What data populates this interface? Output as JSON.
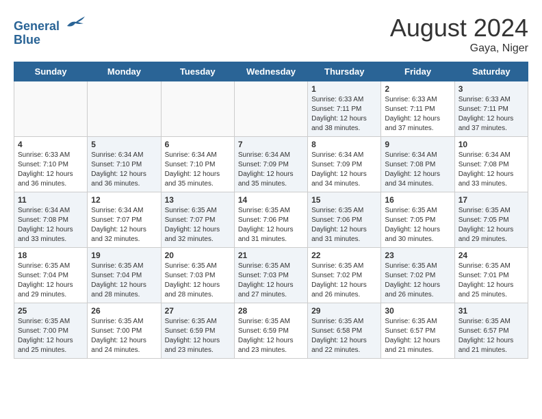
{
  "header": {
    "logo_line1": "General",
    "logo_line2": "Blue",
    "month_title": "August 2024",
    "location": "Gaya, Niger"
  },
  "days_of_week": [
    "Sunday",
    "Monday",
    "Tuesday",
    "Wednesday",
    "Thursday",
    "Friday",
    "Saturday"
  ],
  "weeks": [
    [
      {
        "day": "",
        "info": ""
      },
      {
        "day": "",
        "info": ""
      },
      {
        "day": "",
        "info": ""
      },
      {
        "day": "",
        "info": ""
      },
      {
        "day": "1",
        "info": "Sunrise: 6:33 AM\nSunset: 7:11 PM\nDaylight: 12 hours\nand 38 minutes."
      },
      {
        "day": "2",
        "info": "Sunrise: 6:33 AM\nSunset: 7:11 PM\nDaylight: 12 hours\nand 37 minutes."
      },
      {
        "day": "3",
        "info": "Sunrise: 6:33 AM\nSunset: 7:11 PM\nDaylight: 12 hours\nand 37 minutes."
      }
    ],
    [
      {
        "day": "4",
        "info": "Sunrise: 6:33 AM\nSunset: 7:10 PM\nDaylight: 12 hours\nand 36 minutes."
      },
      {
        "day": "5",
        "info": "Sunrise: 6:34 AM\nSunset: 7:10 PM\nDaylight: 12 hours\nand 36 minutes."
      },
      {
        "day": "6",
        "info": "Sunrise: 6:34 AM\nSunset: 7:10 PM\nDaylight: 12 hours\nand 35 minutes."
      },
      {
        "day": "7",
        "info": "Sunrise: 6:34 AM\nSunset: 7:09 PM\nDaylight: 12 hours\nand 35 minutes."
      },
      {
        "day": "8",
        "info": "Sunrise: 6:34 AM\nSunset: 7:09 PM\nDaylight: 12 hours\nand 34 minutes."
      },
      {
        "day": "9",
        "info": "Sunrise: 6:34 AM\nSunset: 7:08 PM\nDaylight: 12 hours\nand 34 minutes."
      },
      {
        "day": "10",
        "info": "Sunrise: 6:34 AM\nSunset: 7:08 PM\nDaylight: 12 hours\nand 33 minutes."
      }
    ],
    [
      {
        "day": "11",
        "info": "Sunrise: 6:34 AM\nSunset: 7:08 PM\nDaylight: 12 hours\nand 33 minutes."
      },
      {
        "day": "12",
        "info": "Sunrise: 6:34 AM\nSunset: 7:07 PM\nDaylight: 12 hours\nand 32 minutes."
      },
      {
        "day": "13",
        "info": "Sunrise: 6:35 AM\nSunset: 7:07 PM\nDaylight: 12 hours\nand 32 minutes."
      },
      {
        "day": "14",
        "info": "Sunrise: 6:35 AM\nSunset: 7:06 PM\nDaylight: 12 hours\nand 31 minutes."
      },
      {
        "day": "15",
        "info": "Sunrise: 6:35 AM\nSunset: 7:06 PM\nDaylight: 12 hours\nand 31 minutes."
      },
      {
        "day": "16",
        "info": "Sunrise: 6:35 AM\nSunset: 7:05 PM\nDaylight: 12 hours\nand 30 minutes."
      },
      {
        "day": "17",
        "info": "Sunrise: 6:35 AM\nSunset: 7:05 PM\nDaylight: 12 hours\nand 29 minutes."
      }
    ],
    [
      {
        "day": "18",
        "info": "Sunrise: 6:35 AM\nSunset: 7:04 PM\nDaylight: 12 hours\nand 29 minutes."
      },
      {
        "day": "19",
        "info": "Sunrise: 6:35 AM\nSunset: 7:04 PM\nDaylight: 12 hours\nand 28 minutes."
      },
      {
        "day": "20",
        "info": "Sunrise: 6:35 AM\nSunset: 7:03 PM\nDaylight: 12 hours\nand 28 minutes."
      },
      {
        "day": "21",
        "info": "Sunrise: 6:35 AM\nSunset: 7:03 PM\nDaylight: 12 hours\nand 27 minutes."
      },
      {
        "day": "22",
        "info": "Sunrise: 6:35 AM\nSunset: 7:02 PM\nDaylight: 12 hours\nand 26 minutes."
      },
      {
        "day": "23",
        "info": "Sunrise: 6:35 AM\nSunset: 7:02 PM\nDaylight: 12 hours\nand 26 minutes."
      },
      {
        "day": "24",
        "info": "Sunrise: 6:35 AM\nSunset: 7:01 PM\nDaylight: 12 hours\nand 25 minutes."
      }
    ],
    [
      {
        "day": "25",
        "info": "Sunrise: 6:35 AM\nSunset: 7:00 PM\nDaylight: 12 hours\nand 25 minutes."
      },
      {
        "day": "26",
        "info": "Sunrise: 6:35 AM\nSunset: 7:00 PM\nDaylight: 12 hours\nand 24 minutes."
      },
      {
        "day": "27",
        "info": "Sunrise: 6:35 AM\nSunset: 6:59 PM\nDaylight: 12 hours\nand 23 minutes."
      },
      {
        "day": "28",
        "info": "Sunrise: 6:35 AM\nSunset: 6:59 PM\nDaylight: 12 hours\nand 23 minutes."
      },
      {
        "day": "29",
        "info": "Sunrise: 6:35 AM\nSunset: 6:58 PM\nDaylight: 12 hours\nand 22 minutes."
      },
      {
        "day": "30",
        "info": "Sunrise: 6:35 AM\nSunset: 6:57 PM\nDaylight: 12 hours\nand 21 minutes."
      },
      {
        "day": "31",
        "info": "Sunrise: 6:35 AM\nSunset: 6:57 PM\nDaylight: 12 hours\nand 21 minutes."
      }
    ]
  ]
}
